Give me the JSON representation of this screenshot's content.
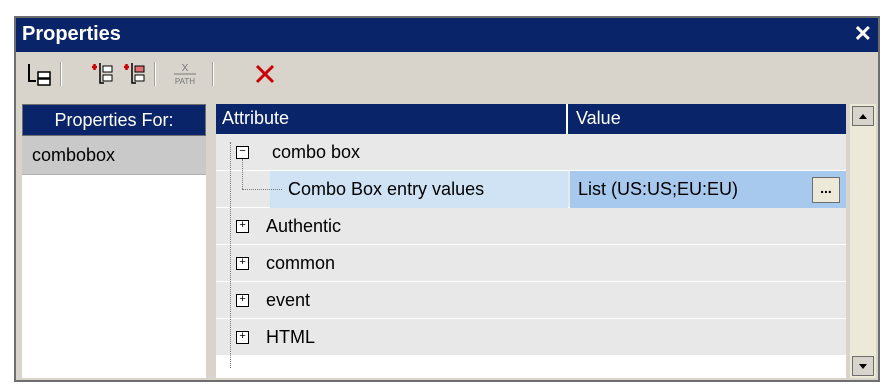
{
  "panel": {
    "title": "Properties",
    "close_glyph": "✕"
  },
  "toolbar": {
    "buttons": [
      {
        "name": "tree-view-icon"
      },
      {
        "name": "insert-attribute-before-icon"
      },
      {
        "name": "insert-attribute-after-icon"
      },
      {
        "name": "xpath-icon",
        "label": "PATH"
      },
      {
        "name": "delete-icon"
      }
    ]
  },
  "left": {
    "header": "Properties For:",
    "items": [
      "combobox"
    ]
  },
  "grid": {
    "col_attribute": "Attribute",
    "col_value": "Value",
    "rows": [
      {
        "label": "combo box",
        "expander": "−"
      },
      {
        "label": "Combo Box entry values",
        "value": "List (US:US;EU:EU)",
        "button": "..."
      },
      {
        "label": "Authentic",
        "expander": "+"
      },
      {
        "label": "common",
        "expander": "+"
      },
      {
        "label": "event",
        "expander": "+"
      },
      {
        "label": "HTML",
        "expander": "+"
      }
    ]
  },
  "colors": {
    "title_bg": "#0a246a",
    "selected_value_bg": "#a8c9ee",
    "delete": "#cc0000"
  }
}
